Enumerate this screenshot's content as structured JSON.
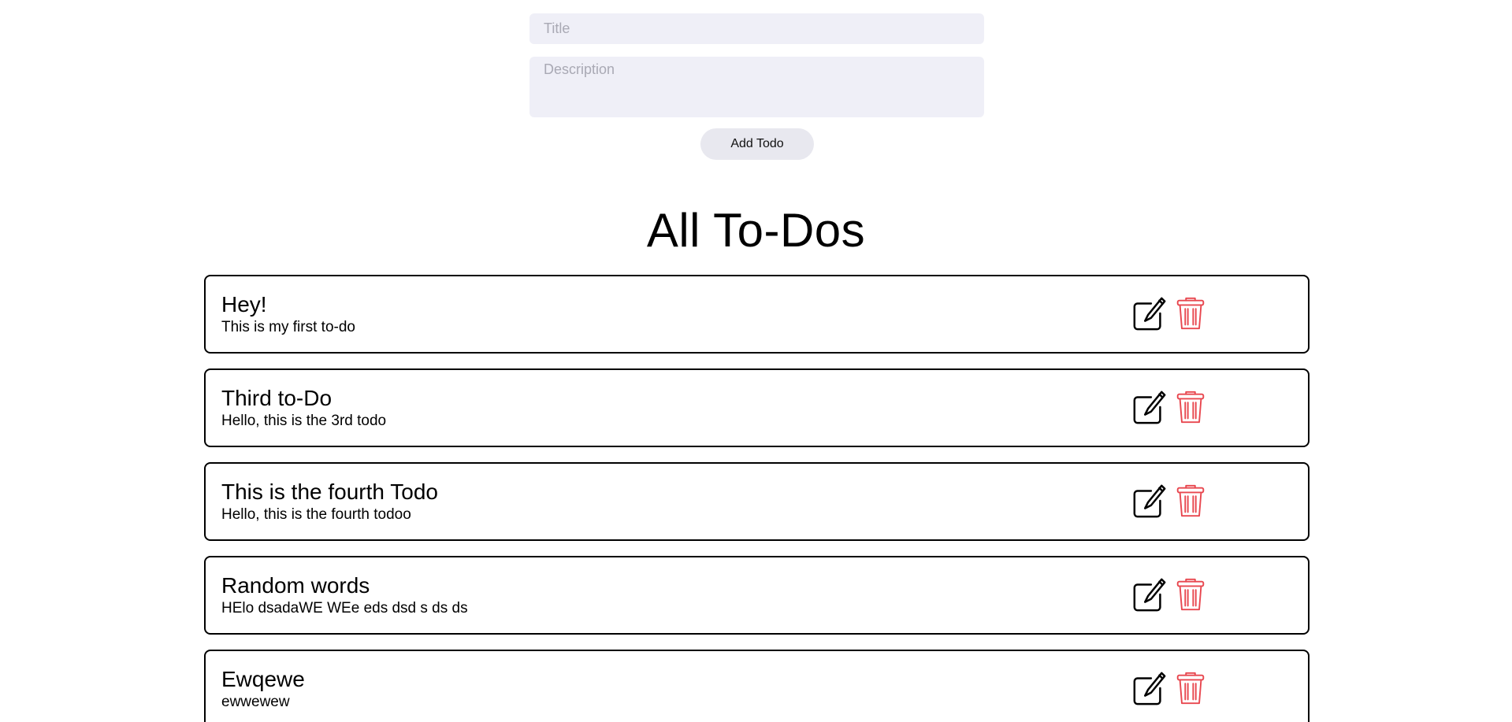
{
  "form": {
    "title_placeholder": "Title",
    "description_placeholder": "Description",
    "add_button_label": "Add Todo"
  },
  "heading": "All To-Dos",
  "icons": {
    "edit": "edit-icon",
    "delete": "trash-icon"
  },
  "colors": {
    "delete_icon": "#e8474f",
    "input_bg": "#efeff7",
    "button_bg": "#e8e8ef"
  },
  "todos": [
    {
      "title": "Hey!",
      "description": "This is my first to-do"
    },
    {
      "title": "Third to-Do",
      "description": "Hello, this is the 3rd todo"
    },
    {
      "title": "This is the fourth Todo",
      "description": "Hello, this is the fourth todoo"
    },
    {
      "title": "Random words",
      "description": "HElo dsadaWE WEe eds dsd s ds ds"
    },
    {
      "title": "Ewqewe",
      "description": "ewwewew"
    }
  ]
}
